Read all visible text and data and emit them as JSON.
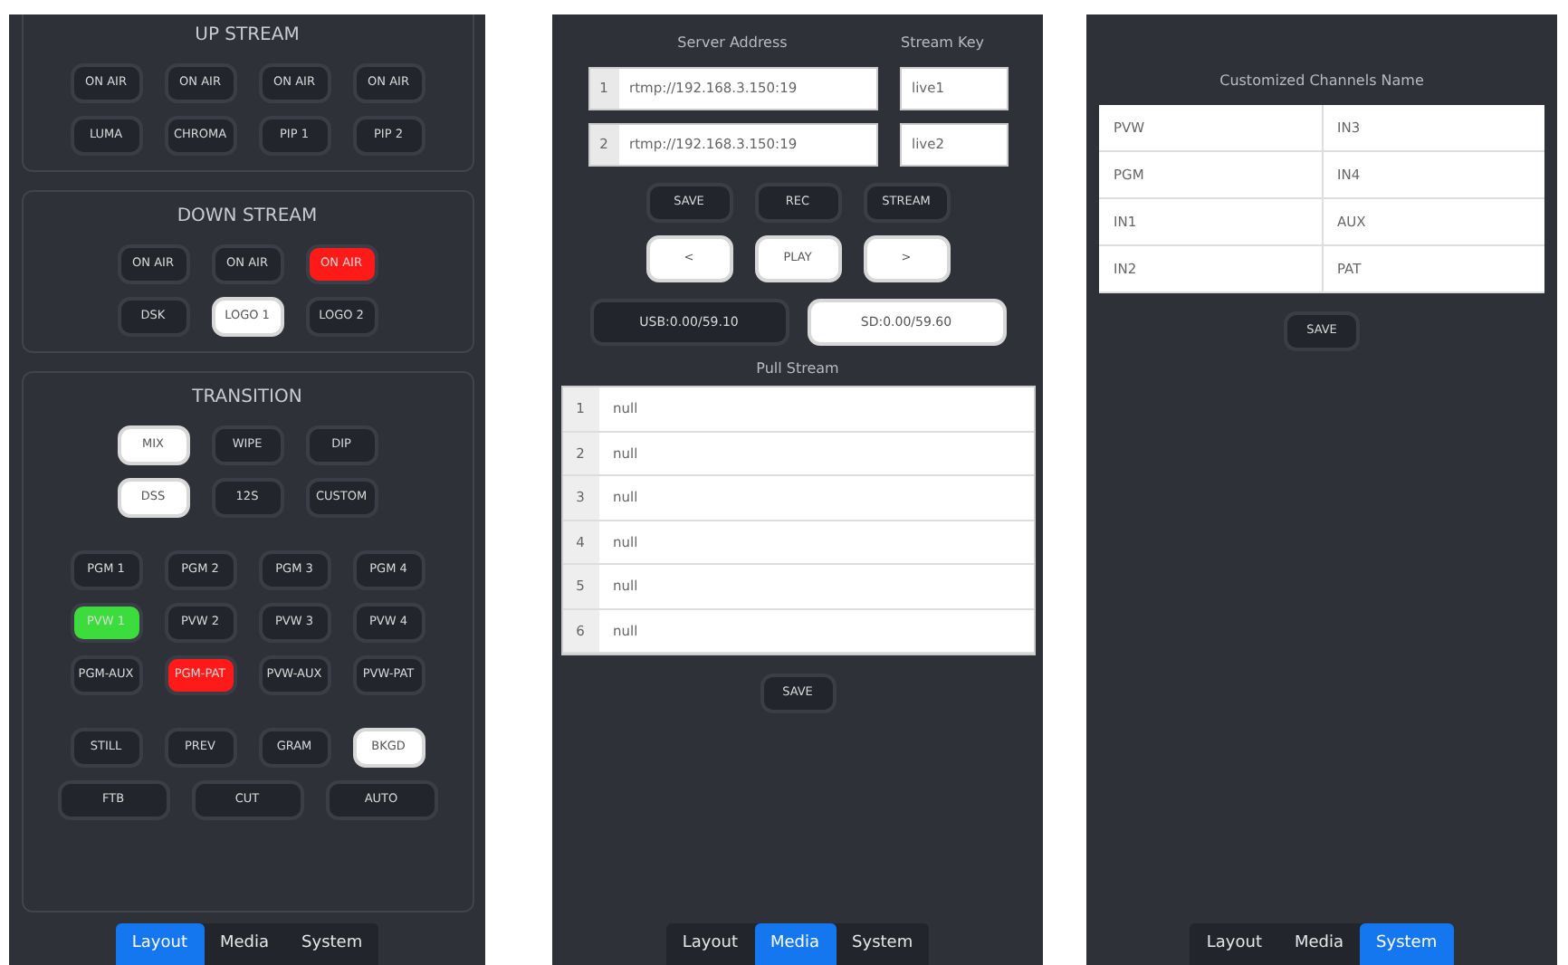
{
  "layout_screen": {
    "sections": [
      {
        "title": "UP STREAM",
        "groups": [
          [
            {
              "buttons": [
                {
                  "label": "ON AIR",
                  "color": "#23252c"
                },
                {
                  "label": "ON AIR",
                  "color": "#23252c"
                },
                {
                  "label": "ON AIR",
                  "color": "#23252c"
                },
                {
                  "label": "ON AIR",
                  "color": "#23252c"
                }
              ]
            },
            {
              "buttons": [
                {
                  "label": "LUMA",
                  "color": "#23252c"
                },
                {
                  "label": "CHROMA",
                  "color": "#23252c"
                },
                {
                  "label": "PIP 1",
                  "color": "#23252c"
                },
                {
                  "label": "PIP 2",
                  "color": "#23252c"
                }
              ]
            }
          ]
        ]
      },
      {
        "title": "DOWN STREAM",
        "groups": [
          [
            {
              "buttons": [
                {
                  "label": "ON AIR",
                  "color": "#23252c"
                },
                {
                  "label": "ON AIR",
                  "color": "#23252c"
                },
                {
                  "label": "ON AIR",
                  "color": "#ff1a1a"
                }
              ]
            },
            {
              "buttons": [
                {
                  "label": "DSK",
                  "color": "#23252c"
                },
                {
                  "label": "LOGO 1",
                  "color": "#ffffff"
                },
                {
                  "label": "LOGO 2",
                  "color": "#23252c"
                }
              ]
            }
          ]
        ]
      },
      {
        "title": "TRANSITION",
        "groups": [
          [
            {
              "buttons": [
                {
                  "label": "MIX",
                  "color": "#ffffff"
                },
                {
                  "label": "WIPE",
                  "color": "#23252c"
                },
                {
                  "label": "DIP",
                  "color": "#23252c"
                }
              ]
            },
            {
              "buttons": [
                {
                  "label": "DSS",
                  "color": "#ffffff"
                },
                {
                  "label": "12S",
                  "color": "#23252c"
                },
                {
                  "label": "CUSTOM",
                  "color": "#23252c"
                }
              ]
            }
          ],
          [
            {
              "buttons": [
                {
                  "label": "PGM 1",
                  "color": "#23252c"
                },
                {
                  "label": "PGM 2",
                  "color": "#23252c"
                },
                {
                  "label": "PGM 3",
                  "color": "#23252c"
                },
                {
                  "label": "PGM 4",
                  "color": "#23252c"
                }
              ]
            },
            {
              "buttons": [
                {
                  "label": "PVW 1",
                  "color": "#3ddc3d"
                },
                {
                  "label": "PVW 2",
                  "color": "#23252c"
                },
                {
                  "label": "PVW 3",
                  "color": "#23252c"
                },
                {
                  "label": "PVW 4",
                  "color": "#23252c"
                }
              ]
            },
            {
              "buttons": [
                {
                  "label": "PGM-AUX",
                  "color": "#23252c"
                },
                {
                  "label": "PGM-PAT",
                  "color": "#ff1a1a"
                },
                {
                  "label": "PVW-AUX",
                  "color": "#23252c"
                },
                {
                  "label": "PVW-PAT",
                  "color": "#23252c"
                }
              ]
            }
          ],
          [
            {
              "buttons": [
                {
                  "label": "STILL",
                  "color": "#23252c"
                },
                {
                  "label": "PREV",
                  "color": "#23252c"
                },
                {
                  "label": "GRAM",
                  "color": "#23252c"
                },
                {
                  "label": "BKGD",
                  "color": "#ffffff"
                }
              ]
            },
            {
              "kind": "wide",
              "buttons": [
                {
                  "label": "FTB",
                  "color": "#23252c"
                },
                {
                  "label": "CUT",
                  "color": "#23252c"
                },
                {
                  "label": "AUTO",
                  "color": "#23252c"
                }
              ]
            }
          ]
        ]
      }
    ],
    "tabs": [
      {
        "label": "Layout",
        "selected": true
      },
      {
        "label": "Media",
        "selected": false
      },
      {
        "label": "System",
        "selected": false
      }
    ]
  },
  "media_screen": {
    "server_address_heading": "Server Address",
    "stream_key_heading": "Stream Key",
    "servers": [
      {
        "index": "1",
        "address": "rtmp://192.168.3.150:19",
        "key": "live1"
      },
      {
        "index": "2",
        "address": "rtmp://192.168.3.150:19",
        "key": "live2"
      }
    ],
    "button_rows": [
      [
        {
          "label": "SAVE",
          "color": "#23252c"
        },
        {
          "label": "REC",
          "color": "#23252c"
        },
        {
          "label": "STREAM",
          "color": "#23252c"
        }
      ],
      [
        {
          "label": "<",
          "color": "#ffffff"
        },
        {
          "label": "PLAY",
          "color": "#ffffff"
        },
        {
          "label": ">",
          "color": "#ffffff"
        }
      ]
    ],
    "storage": [
      {
        "label": "USB:0.00/59.10",
        "color": "#23252c"
      },
      {
        "label": "SD:0.00/59.60",
        "color": "#ffffff"
      }
    ],
    "pull_stream_heading": "Pull Stream",
    "pull_streams": [
      {
        "index": "1",
        "value": "null"
      },
      {
        "index": "2",
        "value": "null"
      },
      {
        "index": "3",
        "value": "null"
      },
      {
        "index": "4",
        "value": "null"
      },
      {
        "index": "5",
        "value": "null"
      },
      {
        "index": "6",
        "value": "null"
      }
    ],
    "save_button": "SAVE",
    "tabs": [
      {
        "label": "Layout",
        "selected": false
      },
      {
        "label": "Media",
        "selected": true
      },
      {
        "label": "System",
        "selected": false
      }
    ]
  },
  "system_screen": {
    "heading": "Customized Channels Name",
    "channels": [
      [
        "PVW",
        "IN3"
      ],
      [
        "PGM",
        "IN4"
      ],
      [
        "IN1",
        "AUX"
      ],
      [
        "IN2",
        "PAT"
      ]
    ],
    "save_button": "SAVE",
    "tabs": [
      {
        "label": "Layout",
        "selected": false
      },
      {
        "label": "Media",
        "selected": false
      },
      {
        "label": "System",
        "selected": true
      }
    ]
  }
}
